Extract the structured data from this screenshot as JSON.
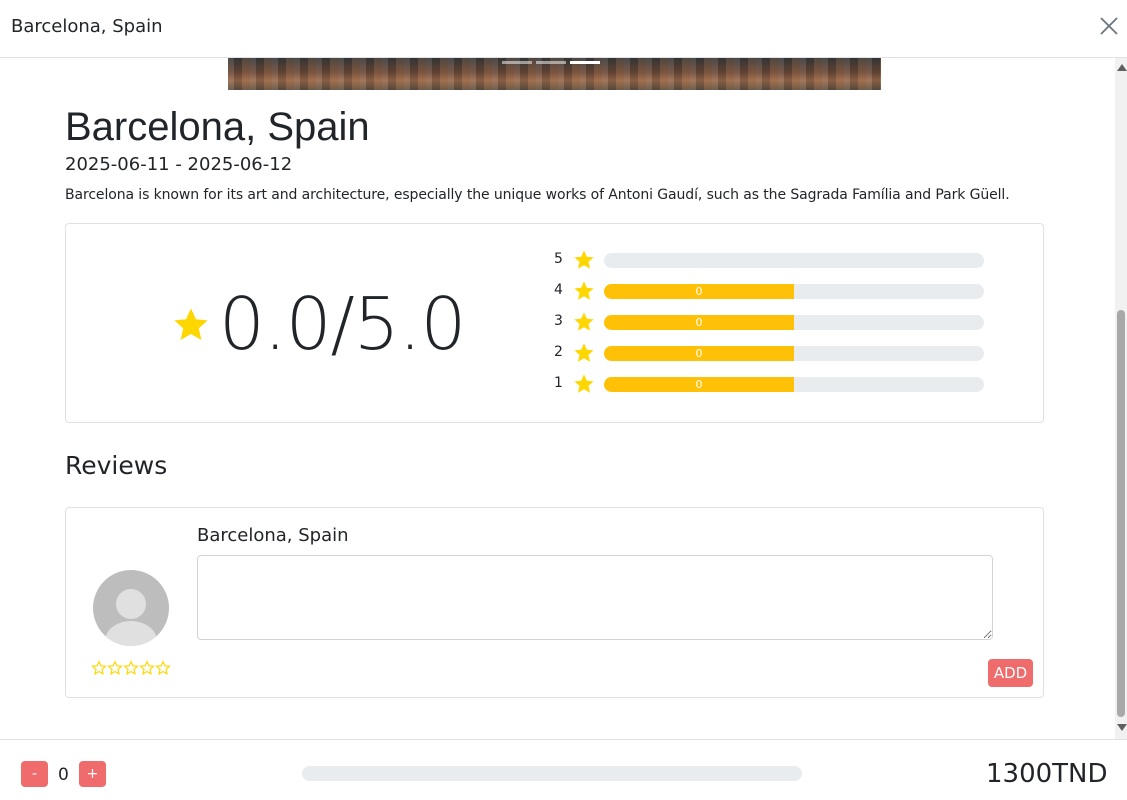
{
  "modal": {
    "title": "Barcelona, Spain",
    "close_icon": "close-icon"
  },
  "carousel": {
    "slide_count": 3,
    "active_index": 2
  },
  "destination": {
    "name": "Barcelona, Spain",
    "dates": "2025-06-11 - 2025-06-12",
    "description": "Barcelona is known for its art and architecture, especially the unique works of Antoni Gaudí, such as the Sagrada Família and Park Güell."
  },
  "rating": {
    "average_display": "0.0/5.0",
    "star_icon": "star-icon",
    "star_color": "#ffd700",
    "bar_fill_color": "#ffc107",
    "breakdown": [
      {
        "stars": "5",
        "count_label": "",
        "fill_percent": 0
      },
      {
        "stars": "4",
        "count_label": "0",
        "fill_percent": 50
      },
      {
        "stars": "3",
        "count_label": "0",
        "fill_percent": 50
      },
      {
        "stars": "2",
        "count_label": "0",
        "fill_percent": 50
      },
      {
        "stars": "1",
        "count_label": "0",
        "fill_percent": 50
      }
    ]
  },
  "reviews": {
    "heading": "Reviews",
    "form": {
      "name": "Barcelona, Spain",
      "textarea_value": "",
      "selected_stars": 0,
      "add_label": "ADD",
      "avatar_icon": "avatar-placeholder"
    }
  },
  "footer": {
    "minus_label": "-",
    "plus_label": "+",
    "quantity": "0",
    "progress_percent": 0,
    "price": "1300TND",
    "button_color": "#f06b6b"
  }
}
